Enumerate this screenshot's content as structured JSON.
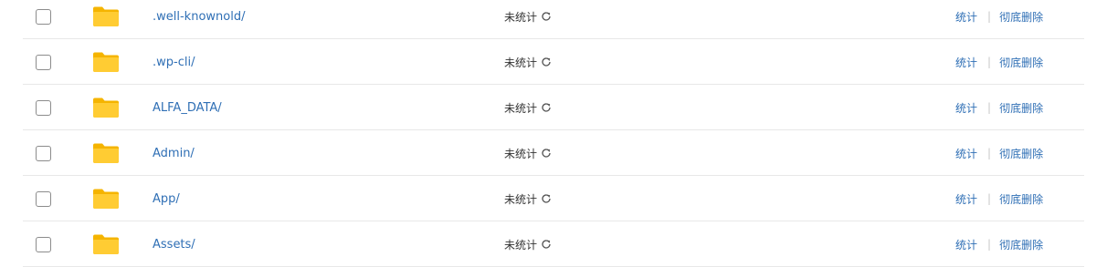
{
  "rows": [
    {
      "name": ".well-knownold/",
      "status": "未统计",
      "stat_label": "统计",
      "delete_label": "彻底删除"
    },
    {
      "name": ".wp-cli/",
      "status": "未统计",
      "stat_label": "统计",
      "delete_label": "彻底删除"
    },
    {
      "name": "ALFA_DATA/",
      "status": "未统计",
      "stat_label": "统计",
      "delete_label": "彻底删除"
    },
    {
      "name": "Admin/",
      "status": "未统计",
      "stat_label": "统计",
      "delete_label": "彻底删除"
    },
    {
      "name": "App/",
      "status": "未统计",
      "stat_label": "统计",
      "delete_label": "彻底删除"
    },
    {
      "name": "Assets/",
      "status": "未统计",
      "stat_label": "统计",
      "delete_label": "彻底删除"
    }
  ],
  "icons": {
    "folder": "folder-icon",
    "refresh": "refresh-icon"
  },
  "colors": {
    "link": "#2f6fb5",
    "folder": "#ffc107",
    "separator": "#c8c8c8"
  }
}
